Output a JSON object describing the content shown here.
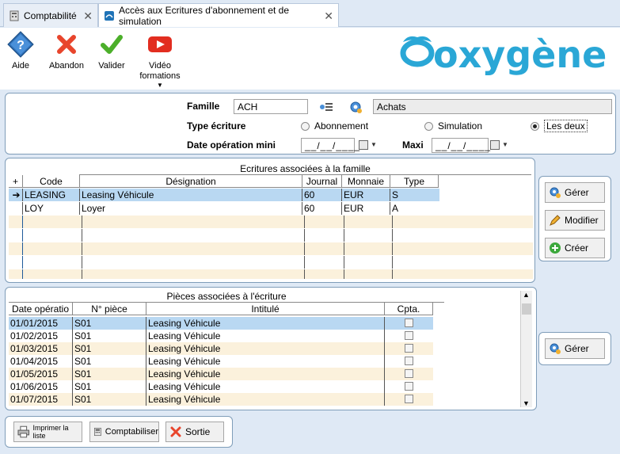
{
  "tabs": [
    {
      "label": "Comptabilité",
      "close": "✕"
    },
    {
      "label": "Accès aux Ecritures d'abonnement et de simulation",
      "close": "✕"
    }
  ],
  "toolbar": {
    "aide": "Aide",
    "abandon": "Abandon",
    "valider": "Valider",
    "video_line1": "Vidéo",
    "video_line2": "formations"
  },
  "brand": {
    "logo_text": "oxygène",
    "color": "#2aa7d6"
  },
  "form": {
    "famille_label": "Famille",
    "famille_value": "ACH",
    "famille_desc": "Achats",
    "type_label": "Type écriture",
    "radio_abonnement": "Abonnement",
    "radio_simulation": "Simulation",
    "radio_lesdeux": "Les deux",
    "selected": "Les deux",
    "date_label": "Date opération mini",
    "date_mini": "__/__/____",
    "maxi_label": "Maxi",
    "date_maxi": "__/__/____"
  },
  "grid1": {
    "title": "Ecritures associées à la famille",
    "columns": [
      "Code",
      "Désignation",
      "Journal",
      "Monnaie",
      "Type"
    ],
    "rows": [
      {
        "code": "LEASING",
        "designation": "Leasing Véhicule",
        "journal": "60",
        "monnaie": "EUR",
        "type": "S"
      },
      {
        "code": "LOY",
        "designation": "Loyer",
        "journal": "60",
        "monnaie": "EUR",
        "type": "A"
      }
    ],
    "selected_row": 0
  },
  "side1": {
    "gerer": "Gérer",
    "modifier": "Modifier",
    "creer": "Créer"
  },
  "grid2": {
    "title": "Pièces associées à l'écriture",
    "columns": [
      "Date opératio",
      "N° pièce",
      "Intitulé",
      "Cpta."
    ],
    "rows": [
      {
        "date": "01/01/2015",
        "piece": "S01",
        "intitule": "Leasing Véhicule"
      },
      {
        "date": "01/02/2015",
        "piece": "S01",
        "intitule": "Leasing Véhicule"
      },
      {
        "date": "01/03/2015",
        "piece": "S01",
        "intitule": "Leasing Véhicule"
      },
      {
        "date": "01/04/2015",
        "piece": "S01",
        "intitule": "Leasing Véhicule"
      },
      {
        "date": "01/05/2015",
        "piece": "S01",
        "intitule": "Leasing Véhicule"
      },
      {
        "date": "01/06/2015",
        "piece": "S01",
        "intitule": "Leasing Véhicule"
      },
      {
        "date": "01/07/2015",
        "piece": "S01",
        "intitule": "Leasing Véhicule"
      }
    ]
  },
  "side2": {
    "gerer": "Gérer"
  },
  "bottom": {
    "imprimer": "Imprimer la liste",
    "comptabiliser": "Comptabiliser",
    "sortie": "Sortie"
  },
  "colors": {
    "selected_row": "#b9d8f2",
    "alt_row": "#fbf1dc",
    "accent": "#2aa7d6"
  }
}
